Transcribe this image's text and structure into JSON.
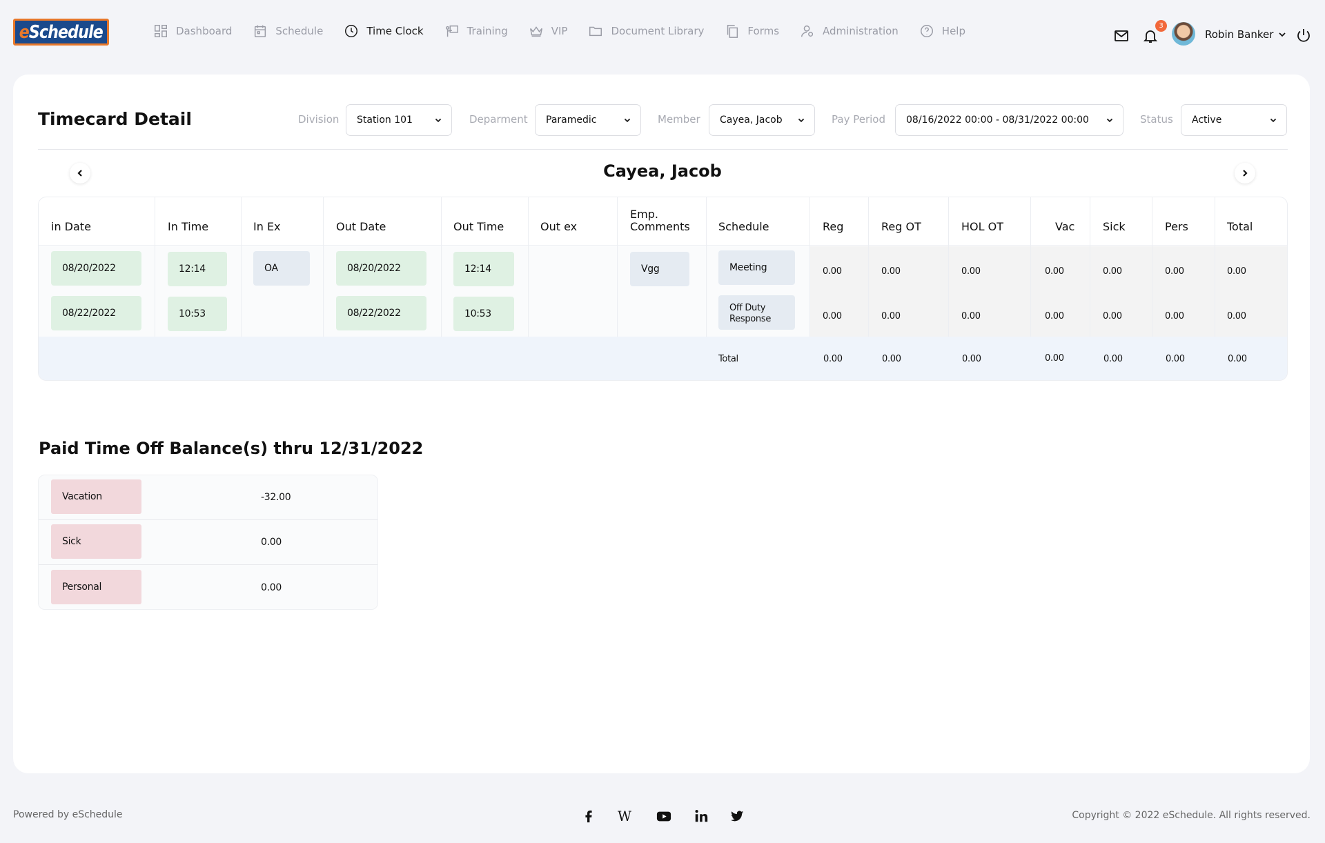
{
  "app": {
    "logo_e": "e",
    "logo_rest": "Schedule"
  },
  "nav": {
    "items": [
      {
        "label": "Dashboard",
        "icon": "grid-icon"
      },
      {
        "label": "Schedule",
        "icon": "calendar-icon"
      },
      {
        "label": "Time Clock",
        "icon": "clock-icon"
      },
      {
        "label": "Training",
        "icon": "training-icon"
      },
      {
        "label": "VIP",
        "icon": "crown-icon"
      },
      {
        "label": "Document Library",
        "icon": "folder-icon"
      },
      {
        "label": "Forms",
        "icon": "forms-icon"
      },
      {
        "label": "Administration",
        "icon": "admin-icon"
      },
      {
        "label": "Help",
        "icon": "help-icon"
      }
    ],
    "active": "Time Clock"
  },
  "header": {
    "notification_count": "3",
    "user_name": "Robin Banker"
  },
  "page": {
    "title": "Timecard Detail",
    "member_name": "Cayea, Jacob"
  },
  "filters": {
    "division": {
      "label": "Division",
      "value": "Station 101"
    },
    "department": {
      "label": "Deparment",
      "value": "Paramedic"
    },
    "member": {
      "label": "Member",
      "value": "Cayea, Jacob"
    },
    "pay_period": {
      "label": "Pay Period",
      "value": "08/16/2022 00:00 - 08/31/2022 00:00"
    },
    "status": {
      "label": "Status",
      "value": "Active"
    }
  },
  "timecard": {
    "columns": [
      "in Date",
      "In Time",
      "In Ex",
      "Out Date",
      "Out Time",
      "Out ex",
      "Emp. Comments",
      "Schedule",
      "Reg",
      "Reg OT",
      "HOL OT",
      "Vac",
      "Sick",
      "Pers",
      "Total"
    ],
    "rows": [
      {
        "in_date": "08/20/2022",
        "in_time": "12:14",
        "in_ex": "OA",
        "out_date": "08/20/2022",
        "out_time": "12:14",
        "out_ex": "",
        "comments": "Vgg",
        "schedule": "Meeting",
        "reg": "0.00",
        "reg_ot": "0.00",
        "hol_ot": "0.00",
        "vac": "0.00",
        "sick": "0.00",
        "pers": "0.00",
        "total": "0.00"
      },
      {
        "in_date": "08/22/2022",
        "in_time": "10:53",
        "in_ex": "",
        "out_date": "08/22/2022",
        "out_time": "10:53",
        "out_ex": "",
        "comments": "",
        "schedule": "Off Duty Response",
        "reg": "0.00",
        "reg_ot": "0.00",
        "hol_ot": "0.00",
        "vac": "0.00",
        "sick": "0.00",
        "pers": "0.00",
        "total": "0.00"
      }
    ],
    "totals": {
      "label": "Total",
      "reg": "0.00",
      "reg_ot": "0.00",
      "hol_ot": "0.00",
      "vac": "0.00",
      "sick": "0.00",
      "pers": "0.00",
      "total": "0.00"
    }
  },
  "pto": {
    "title": "Paid Time Off Balance(s) thru 12/31/2022",
    "rows": [
      {
        "label": "Vacation",
        "value": "-32.00"
      },
      {
        "label": "Sick",
        "value": "0.00"
      },
      {
        "label": "Personal",
        "value": "0.00"
      }
    ]
  },
  "footer": {
    "powered_by": "Powered by eSchedule",
    "copyright": "Copyright © 2022 eSchedule. All rights reserved.",
    "social": [
      "facebook-icon",
      "wikipedia-icon",
      "youtube-icon",
      "linkedin-icon",
      "twitter-icon"
    ]
  },
  "colors": {
    "accent_orange": "#f2683a",
    "logo_blue": "#1b4a8c",
    "time_cell_green": "#dff1e3",
    "schedule_cell_blue": "#e5ebf2",
    "pto_label_pink": "#f2d8dc",
    "total_row_blue": "#eff4fb"
  }
}
